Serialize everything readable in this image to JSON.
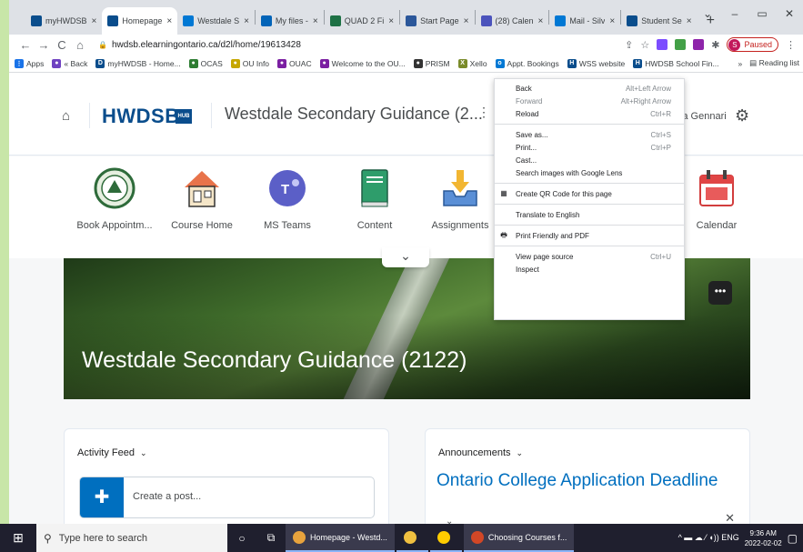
{
  "browser": {
    "tabs": [
      {
        "title": "myHWDSB",
        "favicon_color": "#0a4d8c",
        "active": false
      },
      {
        "title": "Homepage",
        "favicon_color": "#0a4d8c",
        "active": true
      },
      {
        "title": "Westdale S",
        "favicon_color": "#0078d4",
        "active": false
      },
      {
        "title": "My files -",
        "favicon_color": "#0364b8",
        "active": false
      },
      {
        "title": "QUAD 2 Fi",
        "favicon_color": "#1e7145",
        "active": false
      },
      {
        "title": "Start Page",
        "favicon_color": "#2b579a",
        "active": false
      },
      {
        "title": "(28) Calen",
        "favicon_color": "#4b53bc",
        "active": false
      },
      {
        "title": "Mail - Silv",
        "favicon_color": "#0078d4",
        "active": false
      },
      {
        "title": "Student Se",
        "favicon_color": "#0a4d8c",
        "active": false
      }
    ],
    "tab_close": "×",
    "new_tab": "+",
    "window_controls": {
      "dropdown": "⌄",
      "minimize": "–",
      "maximize": "▭",
      "close": "✕"
    },
    "nav": {
      "back": "←",
      "forward": "→",
      "reload": "C",
      "home": "⌂"
    },
    "url": "hwdsb.elearningontario.ca/d2l/home/19613428",
    "profile": {
      "initial": "S",
      "status": "Paused"
    },
    "toolbar_icons": {
      "share": "⇪",
      "star": "☆",
      "puzzle": "✱",
      "menu": "⋮"
    },
    "bookmarks": [
      {
        "label": "Apps",
        "color": "#1a73e8",
        "glyph": "⋮"
      },
      {
        "label": "« Back",
        "color": "#6f42c1",
        "glyph": "●"
      },
      {
        "label": "myHWDSB - Home...",
        "color": "#0a4d8c",
        "glyph": "D"
      },
      {
        "label": "OCAS",
        "color": "#2e7d32",
        "glyph": "●"
      },
      {
        "label": "OU Info",
        "color": "#c6a700",
        "glyph": "●"
      },
      {
        "label": "OUAC",
        "color": "#7b1fa2",
        "glyph": "●"
      },
      {
        "label": "Welcome to the OU...",
        "color": "#7b1fa2",
        "glyph": "●"
      },
      {
        "label": "PRISM",
        "color": "#333333",
        "glyph": "●"
      },
      {
        "label": "Xello",
        "color": "#7a8b2a",
        "glyph": "X"
      },
      {
        "label": "Appt. Bookings",
        "color": "#0078d4",
        "glyph": "o"
      },
      {
        "label": "WSS website",
        "color": "#0a4d8c",
        "glyph": "H"
      },
      {
        "label": "HWDSB School Fin...",
        "color": "#0a4d8c",
        "glyph": "H"
      }
    ],
    "bookmarks_more": "»",
    "reading_list": "Reading list"
  },
  "d2l": {
    "logo_text": "HWDSB",
    "logo_badge": "HUB",
    "course_title": "Westdale Secondary Guidance (2...",
    "user_name": "lvia Gennari",
    "home_glyph": "⌂",
    "grid_glyph": "⋮⋮",
    "gear_glyph": "⚙",
    "nav_items": [
      {
        "label": "Book Appointm...",
        "icon": "school-seal"
      },
      {
        "label": "Course Home",
        "icon": "house"
      },
      {
        "label": "MS Teams",
        "icon": "teams"
      },
      {
        "label": "Content",
        "icon": "book"
      },
      {
        "label": "Assignments",
        "icon": "inbox-arrow"
      },
      {
        "label": "Calendar",
        "icon": "calendar"
      }
    ],
    "expand_glyph": "⌄",
    "banner": {
      "title": "Westdale Secondary Guidance (2122)",
      "more": "•••"
    },
    "activity_feed": {
      "heading": "Activity Feed",
      "chevron": "⌄",
      "placeholder": "Create a post...",
      "plus": "✚"
    },
    "announcements": {
      "heading": "Announcements",
      "chevron": "⌄",
      "title": "Ontario College Application Deadline",
      "close": "✕",
      "expand": "⌄"
    }
  },
  "context_menu": {
    "items": [
      {
        "label": "Back",
        "shortcut": "Alt+Left Arrow",
        "disabled": false
      },
      {
        "label": "Forward",
        "shortcut": "Alt+Right Arrow",
        "disabled": true
      },
      {
        "label": "Reload",
        "shortcut": "Ctrl+R",
        "disabled": false
      },
      {
        "sep": true
      },
      {
        "label": "Save as...",
        "shortcut": "Ctrl+S",
        "disabled": false
      },
      {
        "label": "Print...",
        "shortcut": "Ctrl+P",
        "disabled": false
      },
      {
        "label": "Cast...",
        "shortcut": "",
        "disabled": false
      },
      {
        "label": "Search images with Google Lens",
        "shortcut": "",
        "disabled": false
      },
      {
        "sep": true
      },
      {
        "label": "Create QR Code for this page",
        "shortcut": "",
        "disabled": false,
        "icon": "▦"
      },
      {
        "sep": true
      },
      {
        "label": "Translate to English",
        "shortcut": "",
        "disabled": false
      },
      {
        "sep": true
      },
      {
        "label": "Print Friendly and PDF",
        "shortcut": "",
        "disabled": false,
        "icon": "🖶"
      },
      {
        "sep": true
      },
      {
        "label": "View page source",
        "shortcut": "Ctrl+U",
        "disabled": false
      },
      {
        "label": "Inspect",
        "shortcut": "",
        "disabled": false
      }
    ]
  },
  "taskbar": {
    "search_placeholder": "Type here to search",
    "apps": [
      {
        "label": "Homepage - Westd...",
        "color": "#e8a33d"
      },
      {
        "label": "",
        "color": "#f0c040"
      },
      {
        "label": "",
        "color": "#ffcc00"
      },
      {
        "label": "Choosing Courses f...",
        "color": "#d24726"
      }
    ],
    "tray_icons": "^ ▬ ☁ ⁄ ◖)) ENG",
    "time": "9:36 AM",
    "date": "2022-02-02",
    "notification": "▢"
  }
}
